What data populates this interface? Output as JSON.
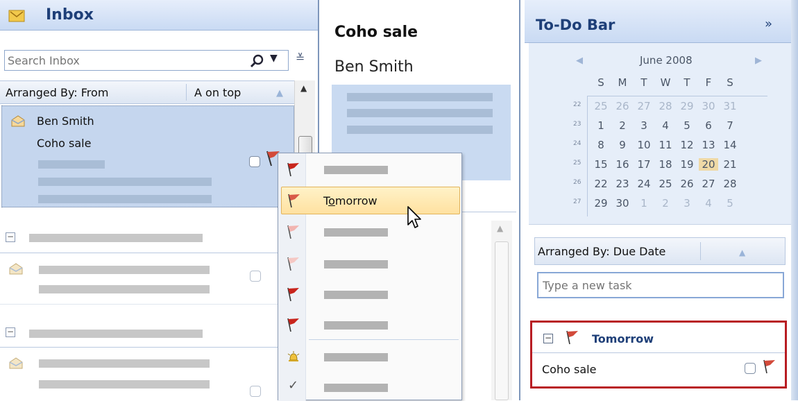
{
  "inbox": {
    "title": "Inbox",
    "search_placeholder": "Search Inbox",
    "arranged_by": "Arranged By: From",
    "sort_order": "A on top",
    "selected_message": {
      "sender": "Ben Smith",
      "subject": "Coho sale"
    }
  },
  "reading_pane": {
    "subject": "Coho sale",
    "sender": "Ben Smith"
  },
  "flag_menu": {
    "highlighted_item": "Tomorrow",
    "highlighted_item_mnemonic_letter": "o"
  },
  "todo_bar": {
    "title": "To-Do Bar",
    "collapse_glyph": "»",
    "calendar": {
      "month_label": "June 2008",
      "weekday_headers": [
        "S",
        "M",
        "T",
        "W",
        "T",
        "F",
        "S"
      ],
      "weeks": [
        {
          "week": "22",
          "days": [
            "25",
            "26",
            "27",
            "28",
            "29",
            "30",
            "31"
          ],
          "dim": [
            true,
            true,
            true,
            true,
            true,
            true,
            true
          ]
        },
        {
          "week": "23",
          "days": [
            "1",
            "2",
            "3",
            "4",
            "5",
            "6",
            "7"
          ],
          "dim": [
            false,
            false,
            false,
            false,
            false,
            false,
            false
          ]
        },
        {
          "week": "24",
          "days": [
            "8",
            "9",
            "10",
            "11",
            "12",
            "13",
            "14"
          ],
          "dim": [
            false,
            false,
            false,
            false,
            false,
            false,
            false
          ]
        },
        {
          "week": "25",
          "days": [
            "15",
            "16",
            "17",
            "18",
            "19",
            "20",
            "21"
          ],
          "dim": [
            false,
            false,
            false,
            false,
            false,
            false,
            false
          ]
        },
        {
          "week": "26",
          "days": [
            "22",
            "23",
            "24",
            "25",
            "26",
            "27",
            "28"
          ],
          "dim": [
            false,
            false,
            false,
            false,
            false,
            false,
            false
          ]
        },
        {
          "week": "27",
          "days": [
            "29",
            "30",
            "1",
            "2",
            "3",
            "4",
            "5"
          ],
          "dim": [
            false,
            false,
            true,
            true,
            true,
            true,
            true
          ]
        }
      ],
      "today": "20"
    },
    "arranged_by": "Arranged By: Due Date",
    "new_task_placeholder": "Type a new task",
    "group_label": "Tomorrow",
    "task_subject": "Coho sale"
  },
  "colors": {
    "accent_blue": "#1e3f78",
    "selection_blue": "#c5d6ee",
    "highlight_orange": "#ffe8a8",
    "red_outline": "#b81c22",
    "flag_red": "#c8241c"
  }
}
